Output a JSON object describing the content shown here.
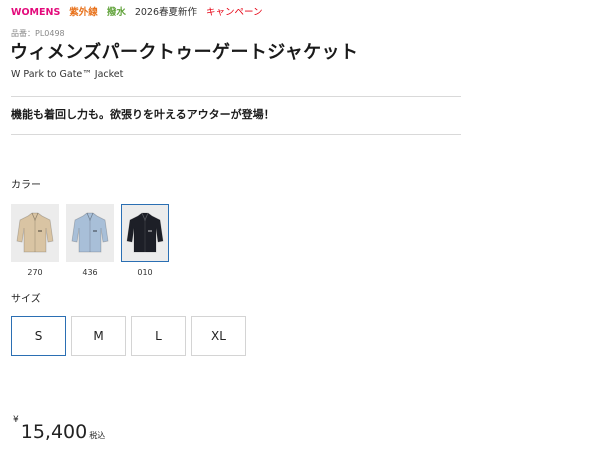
{
  "tags": {
    "womens": "WOMENS",
    "uv": "紫外線",
    "water": "撥水",
    "new": "2026春夏新作",
    "campaign": "キャンペーン"
  },
  "product": {
    "number_label": "品番：",
    "number": "PL0498",
    "name": "ウィメンズパークトゥーゲートジャケット",
    "name_en": "W Park to Gate™ Jacket",
    "catch_copy": "機能も着回し力も。欲張りを叶えるアウターが登場！"
  },
  "color_section": {
    "label": "カラー",
    "swatches": [
      {
        "code": "270",
        "color": "#d9c4a3",
        "selected": false
      },
      {
        "code": "436",
        "color": "#a8bfd8",
        "selected": false
      },
      {
        "code": "010",
        "color": "#1d1f27",
        "selected": true
      }
    ]
  },
  "size_section": {
    "label": "サイズ",
    "sizes": [
      {
        "label": "S",
        "selected": true
      },
      {
        "label": "M",
        "selected": false
      },
      {
        "label": "L",
        "selected": false
      },
      {
        "label": "XL",
        "selected": false
      }
    ]
  },
  "price": {
    "currency": "¥",
    "amount": "15,400",
    "tax_label": "税込"
  },
  "colors": {
    "accent": "#2b6fb3",
    "womens": "#e30a7b",
    "uv": "#e8721c",
    "water": "#62a33c",
    "campaign": "#e60012"
  }
}
